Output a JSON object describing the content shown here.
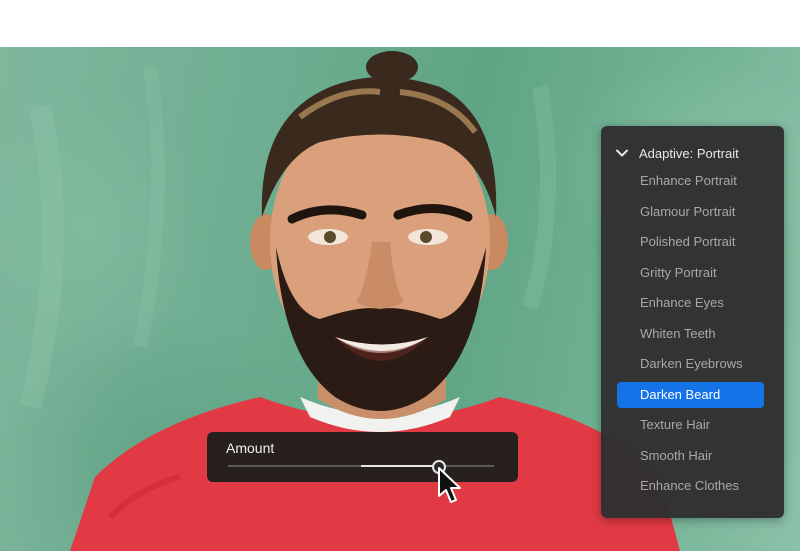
{
  "menu": {
    "header": "Adaptive: Portrait",
    "header_icon": "chevron-down-icon",
    "items": [
      {
        "label": "Enhance Portrait",
        "selected": false
      },
      {
        "label": "Glamour Portrait",
        "selected": false
      },
      {
        "label": "Polished Portrait",
        "selected": false
      },
      {
        "label": "Gritty Portrait",
        "selected": false
      },
      {
        "label": "Enhance Eyes",
        "selected": false
      },
      {
        "label": "Whiten Teeth",
        "selected": false
      },
      {
        "label": "Darken Eyebrows",
        "selected": false
      },
      {
        "label": "Darken Beard",
        "selected": true
      },
      {
        "label": "Texture Hair",
        "selected": false
      },
      {
        "label": "Smooth Hair",
        "selected": false
      },
      {
        "label": "Enhance Clothes",
        "selected": false
      }
    ]
  },
  "slider": {
    "label": "Amount",
    "fill_start": 0.5,
    "value": 0.79
  },
  "colors": {
    "menu_bg": "#303030",
    "selection": "#1473e6",
    "background": "#6fae92",
    "shirt": "#e23a44"
  },
  "icons": {
    "cursor": "arrow-cursor-icon"
  }
}
